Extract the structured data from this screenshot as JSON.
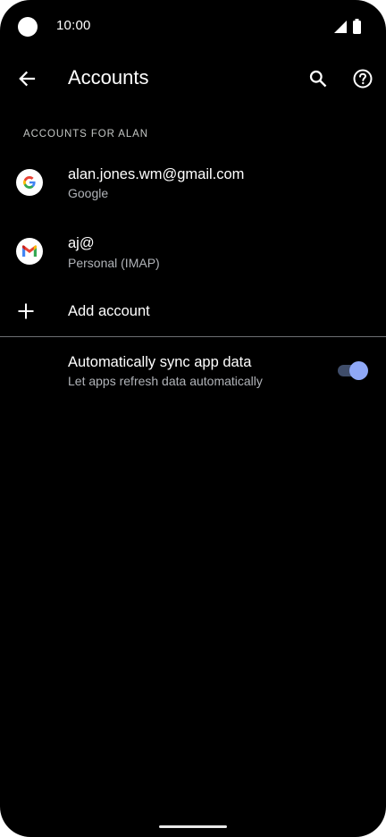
{
  "status_bar": {
    "time": "10:00",
    "icons": [
      "camera-cutout",
      "signal-icon",
      "battery-icon"
    ]
  },
  "app_bar": {
    "title": "Accounts",
    "back_icon": "arrow-back-icon",
    "search_icon": "search-icon",
    "help_icon": "help-icon"
  },
  "section": {
    "header": "ACCOUNTS FOR ALAN"
  },
  "accounts": [
    {
      "title": "alan.jones.wm@gmail.com",
      "subtitle": "Google",
      "icon": "google-icon"
    },
    {
      "title": "aj@",
      "subtitle": "Personal (IMAP)",
      "icon": "gmail-icon"
    }
  ],
  "add_account": {
    "label": "Add account",
    "icon": "plus-icon"
  },
  "sync": {
    "title": "Automatically sync app data",
    "subtitle": "Let apps refresh data automatically",
    "enabled": true
  },
  "colors": {
    "background": "#000000",
    "text_primary": "#ffffff",
    "text_secondary": "#b0b3b8",
    "toggle_thumb": "#8fa8f7",
    "toggle_track": "#3f4d6a",
    "divider": "#6c6f72"
  }
}
